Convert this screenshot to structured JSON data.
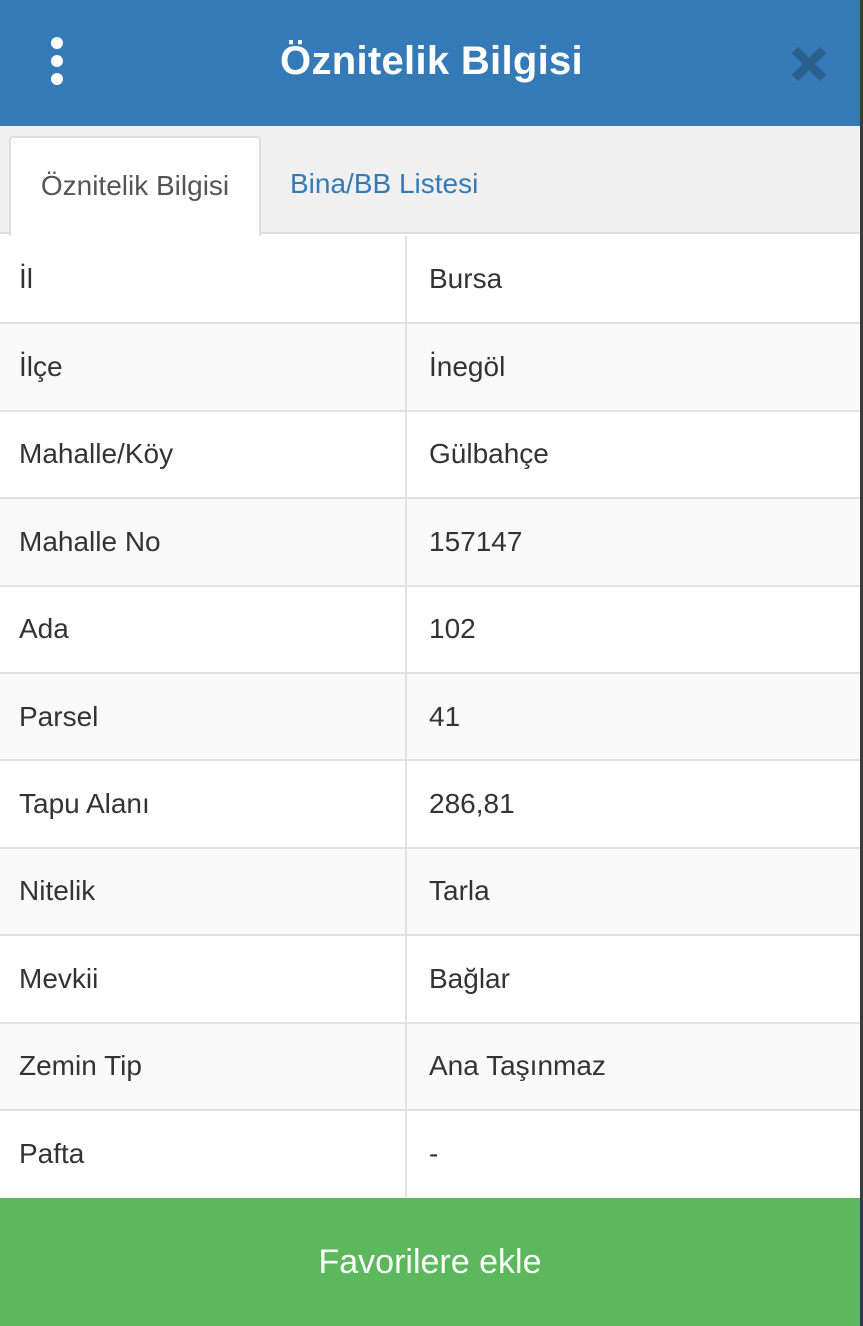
{
  "header": {
    "title": "Öznitelik Bilgisi",
    "menu_icon": "vertical-dots-icon",
    "close_icon": "close-icon",
    "close_color": "#2a5f8e",
    "bg_color": "#337ab7"
  },
  "tabs": [
    {
      "label": "Öznitelik Bilgisi",
      "active": true
    },
    {
      "label": "Bina/BB Listesi",
      "active": false
    }
  ],
  "attributes": [
    {
      "label": "İl",
      "value": "Bursa"
    },
    {
      "label": "İlçe",
      "value": "İnegöl"
    },
    {
      "label": "Mahalle/Köy",
      "value": "Gülbahçe"
    },
    {
      "label": "Mahalle No",
      "value": "157147"
    },
    {
      "label": "Ada",
      "value": "102"
    },
    {
      "label": "Parsel",
      "value": "41"
    },
    {
      "label": "Tapu Alanı",
      "value": "286,81"
    },
    {
      "label": "Nitelik",
      "value": "Tarla"
    },
    {
      "label": "Mevkii",
      "value": "Bağlar"
    },
    {
      "label": "Zemin Tip",
      "value": "Ana Taşınmaz"
    },
    {
      "label": "Pafta",
      "value": "-"
    }
  ],
  "footer": {
    "favorite_label": "Favorilere ekle",
    "button_color": "#5cb85c"
  }
}
